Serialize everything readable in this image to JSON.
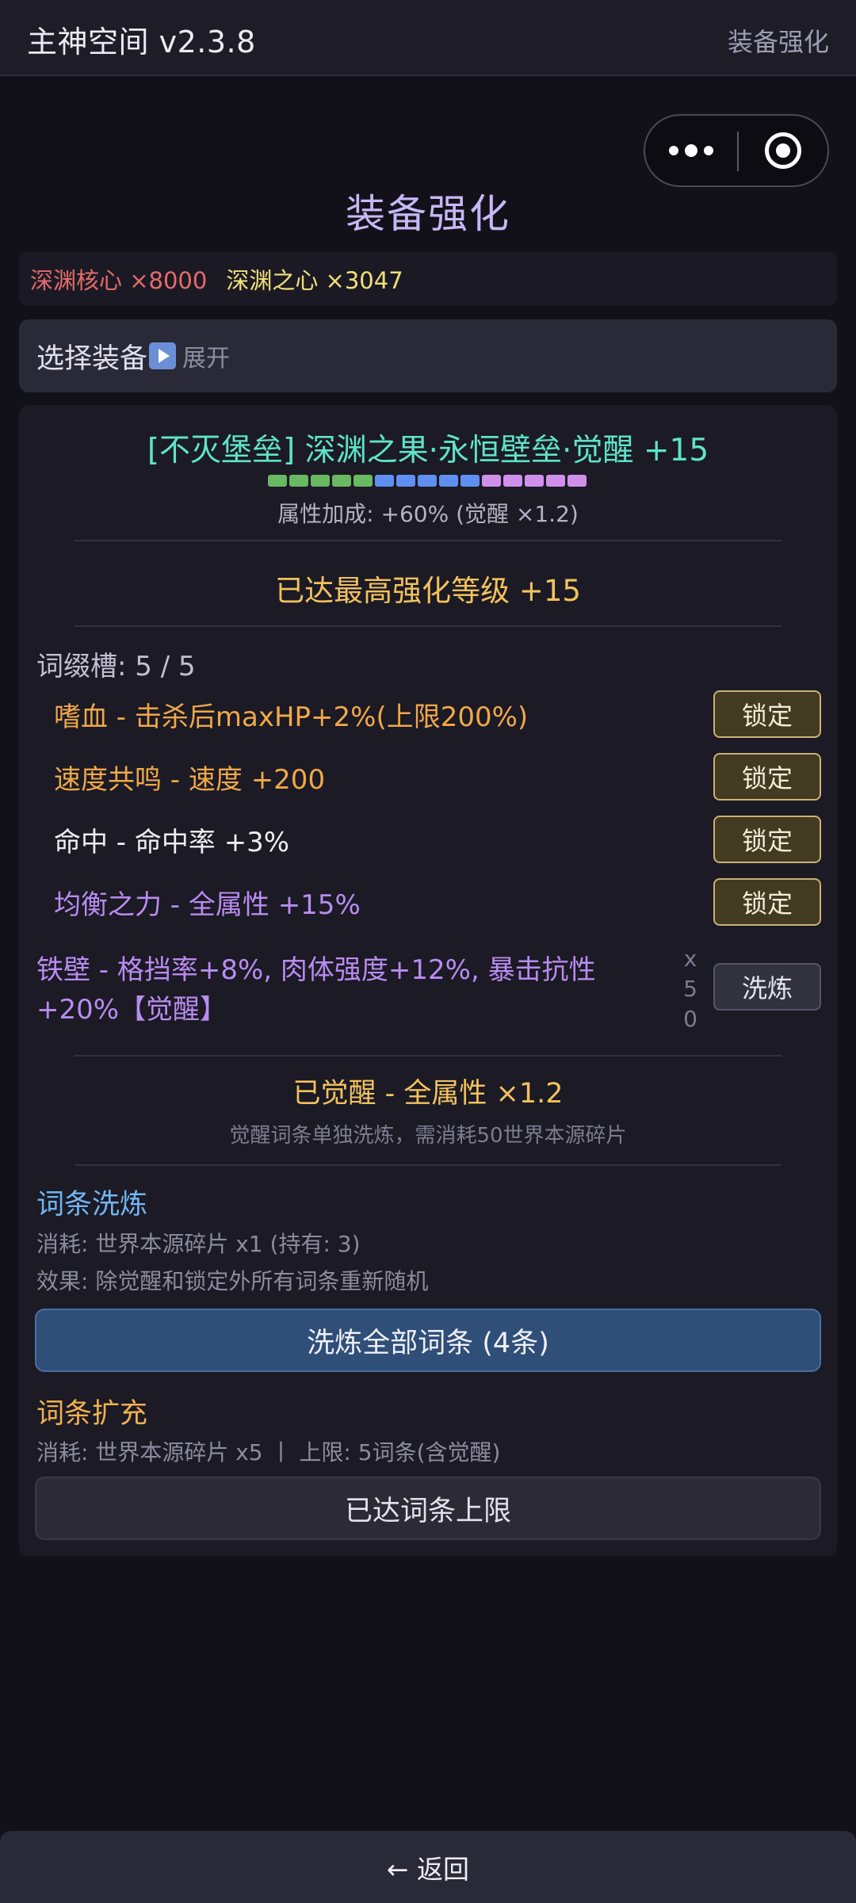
{
  "header": {
    "app_title": "主神空间 v2.3.8",
    "page_label": "装备强化"
  },
  "page_title": "装备强化",
  "currency": {
    "core": "深渊核心 ×8000",
    "heart": "深渊之心 ×3047"
  },
  "select": {
    "label": "选择装备",
    "expand": "展开"
  },
  "equipment": {
    "name": "[不灭堡垒] 深渊之果·永恒壁垒·觉醒 +15",
    "level_segments": {
      "green": 5,
      "blue": 5,
      "purple": 5,
      "colors": {
        "green": "#69b862",
        "blue": "#5f8ff0",
        "purple": "#cf90ec"
      }
    },
    "attr_bonus": "属性加成: +60% (觉醒 ×1.2)",
    "max_level": "已达最高强化等级 +15"
  },
  "affixes": {
    "slots": "词缀槽: 5 / 5",
    "lock_label": "锁定",
    "items": [
      {
        "text": "嗜血 - 击杀后maxHP+2%(上限200%)",
        "color": "#f0a848"
      },
      {
        "text": "速度共鸣 - 速度 +200",
        "color": "#f0a848"
      },
      {
        "text": "命中 - 命中率 +3%",
        "color": "#eeeeee"
      },
      {
        "text": "均衡之力 - 全属性 +15%",
        "color": "#b98cf0"
      }
    ],
    "awaken": {
      "text": "铁壁 - 格挡率+8%, 肉体强度+12%, 暴击抗性+20%【觉醒】",
      "count_x": "x",
      "count_5": "5",
      "count_0": "0",
      "refine_label": "洗炼"
    }
  },
  "awakened": {
    "title": "已觉醒 - 全属性 ×1.2",
    "note": "觉醒词条单独洗炼，需消耗50世界本源碎片"
  },
  "refine_section": {
    "title": "词条洗炼",
    "cost": "消耗: 世界本源碎片 x1 (持有: 3)",
    "effect": "效果: 除觉醒和锁定外所有词条重新随机",
    "button": "洗炼全部词条 (4条)"
  },
  "expand_section": {
    "title": "词条扩充",
    "cost": "消耗: 世界本源碎片 x5 丨 上限: 5词条(含觉醒)",
    "button": "已达词条上限"
  },
  "footer": {
    "back": "← 返回"
  }
}
